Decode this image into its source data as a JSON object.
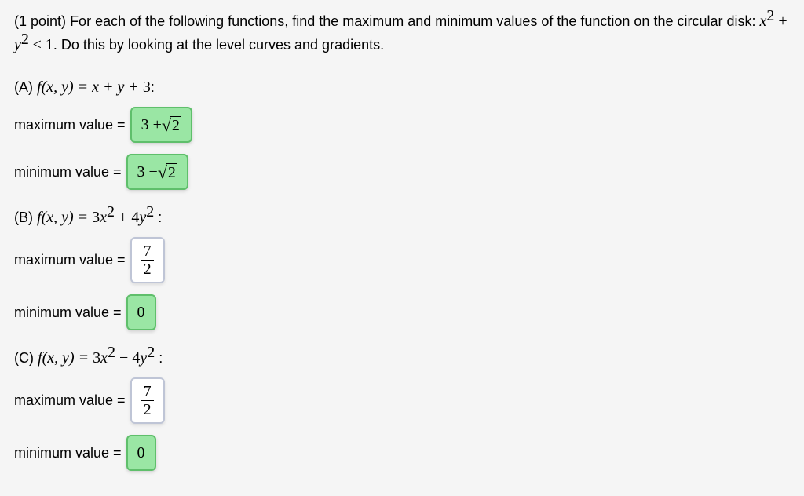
{
  "intro": {
    "points": "(1 point)",
    "text1": "For each of the following functions, find the maximum and minimum values of the function on the circular disk:",
    "constraint_lhs1": "x",
    "constraint_exp1": "2",
    "constraint_plus": " + ",
    "constraint_lhs2": "y",
    "constraint_exp2": "2",
    "constraint_op": " ≤ ",
    "constraint_rhs": "1",
    "text2": ". Do this by looking at the level curves and gradients."
  },
  "partA": {
    "label_prefix": "(A) ",
    "func_f": "f",
    "func_args": "(x, y) = x + y + ",
    "func_const": "3",
    "func_colon": ":",
    "max_label": "maximum value = ",
    "max_val_prefix": "3 + ",
    "max_sqrt_arg": "2",
    "min_label": "minimum value = ",
    "min_val_prefix": "3 − ",
    "min_sqrt_arg": "2"
  },
  "partB": {
    "label_prefix": "(B) ",
    "func_f": "f",
    "func_args_pre": "(x, y) = ",
    "func_coef1": "3",
    "func_var1": "x",
    "func_exp1": "2",
    "func_op": " + ",
    "func_coef2": "4",
    "func_var2": "y",
    "func_exp2": "2",
    "func_colon": " :",
    "max_label": "maximum value = ",
    "max_num": "7",
    "max_den": "2",
    "min_label": "minimum value = ",
    "min_val": "0"
  },
  "partC": {
    "label_prefix": "(C) ",
    "func_f": "f",
    "func_args_pre": "(x, y) = ",
    "func_coef1": "3",
    "func_var1": "x",
    "func_exp1": "2",
    "func_op": " − ",
    "func_coef2": "4",
    "func_var2": "y",
    "func_exp2": "2",
    "func_colon": " :",
    "max_label": "maximum value = ",
    "max_num": "7",
    "max_den": "2",
    "min_label": "minimum value = ",
    "min_val": "0"
  }
}
